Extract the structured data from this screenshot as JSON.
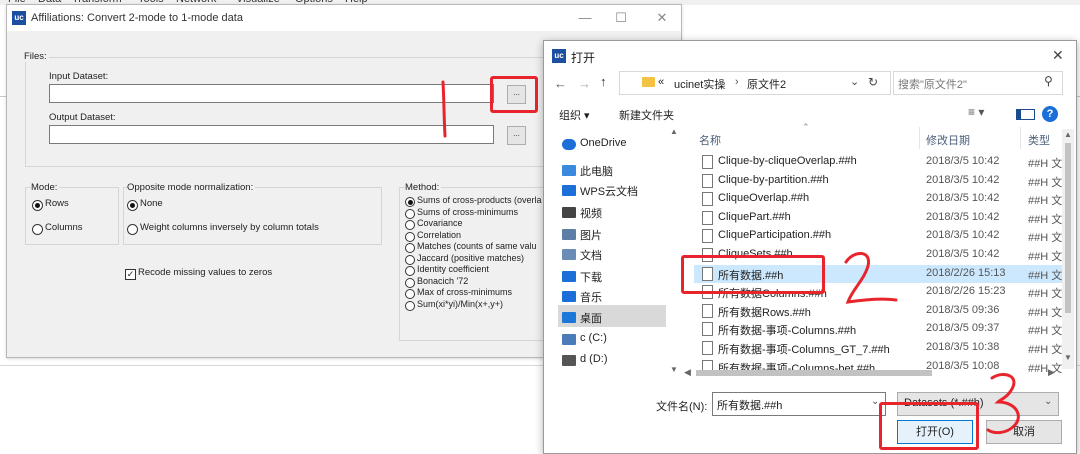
{
  "bg_menubar": [
    "File",
    "Data",
    "Transform",
    "Tools",
    "Network",
    "Visualize",
    "Options",
    "Help"
  ],
  "affiliations": {
    "title": "Affiliations: Convert 2-mode to 1-mode data",
    "files_label": "Files:",
    "input_label": "Input Dataset:",
    "input_value": "",
    "output_label": "Output Dataset:",
    "output_value": "",
    "browse": "...",
    "mode_label": "Mode:",
    "mode_options": [
      "Rows",
      "Columns"
    ],
    "mode_selected": "Rows",
    "norm_label": "Opposite mode normalization:",
    "norm_options": [
      "None",
      "Weight columns inversely by column totals"
    ],
    "recode_label": "Recode missing values to zeros",
    "recode_checked": true,
    "method_label": "Method:",
    "method_options": [
      "Sums of cross-products (overla",
      "Sums of cross-minimums",
      "Covariance",
      "Correlation",
      "Matches (counts of same valu",
      "Jaccard (positive matches)",
      "Identity coefficient",
      "Bonacich '72",
      "Max of cross-minimums",
      "Sum(xi*yi)/Min(x+,y+)"
    ]
  },
  "dialog": {
    "title": "打开",
    "breadcrumb": [
      "«",
      "ucinet实操",
      "原文件2"
    ],
    "search_placeholder": "搜索\"原文件2\"",
    "organize": "组织 ▾",
    "new_folder": "新建文件夹",
    "sidebar": [
      "OneDrive",
      "此电脑",
      "WPS云文档",
      "视频",
      "图片",
      "文档",
      "下载",
      "音乐",
      "桌面",
      "c (C:)",
      "d (D:)"
    ],
    "columns": {
      "name": "名称",
      "date": "修改日期",
      "type": "类型"
    },
    "files": [
      {
        "name": "Clique-by-cliqueOverlap.##h",
        "date": "2018/3/5 10:42",
        "type": "##H 文"
      },
      {
        "name": "Clique-by-partition.##h",
        "date": "2018/3/5 10:42",
        "type": "##H 文"
      },
      {
        "name": "CliqueOverlap.##h",
        "date": "2018/3/5 10:42",
        "type": "##H 文"
      },
      {
        "name": "CliquePart.##h",
        "date": "2018/3/5 10:42",
        "type": "##H 文"
      },
      {
        "name": "CliqueParticipation.##h",
        "date": "2018/3/5 10:42",
        "type": "##H 文"
      },
      {
        "name": "CliqueSets.##h",
        "date": "2018/3/5 10:42",
        "type": "##H 文"
      },
      {
        "name": "所有数据.##h",
        "date": "2018/2/26 15:13",
        "type": "##H 文"
      },
      {
        "name": "所有数据Columns.##h",
        "date": "2018/2/26 15:23",
        "type": "##H 文"
      },
      {
        "name": "所有数据Rows.##h",
        "date": "2018/3/5 09:36",
        "type": "##H 文"
      },
      {
        "name": "所有数据-事项-Columns.##h",
        "date": "2018/3/5 09:37",
        "type": "##H 文"
      },
      {
        "name": "所有数据-事项-Columns_GT_7.##h",
        "date": "2018/3/5 10:38",
        "type": "##H 文"
      },
      {
        "name": "所有数据-事项-Columns-bet.##h",
        "date": "2018/3/5 10:08",
        "type": "##H 文"
      }
    ],
    "filename_label": "文件名(N):",
    "filename_value": "所有数据.##h",
    "filter_value": "Datasets (*.##h)",
    "open_button": "打开(O)",
    "cancel_button": "取消"
  },
  "annotations": [
    "1",
    "2",
    "3"
  ],
  "colors": {
    "annotation_red": "#e8242d",
    "selected_row": "#cce8ff",
    "link_blue": "#1a4c8e"
  }
}
